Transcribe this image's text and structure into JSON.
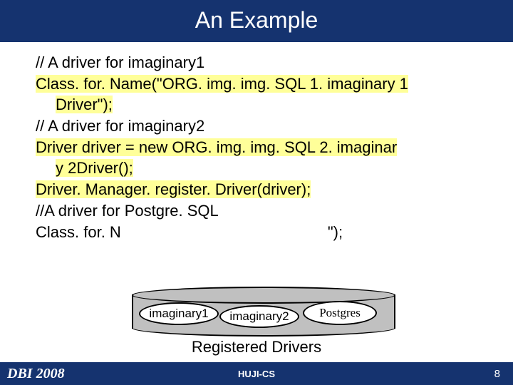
{
  "title": "An Example",
  "code": {
    "c1": "// A driver for imaginary1",
    "c2a": "Class. for. Name(\"ORG. img. img. SQL 1. imaginary 1",
    "c2b": "Driver\");",
    "c3": "// A driver for imaginary2",
    "c4a": "Driver driver = new ORG. img. img. SQL 2. imaginar",
    "c4b": "y 2Driver();",
    "c5": "Driver. Manager. register. Driver(driver);",
    "c6": "//A driver for Postgre. SQL",
    "c7a": "Class. for. N",
    "c7b": "\");"
  },
  "bubbles": {
    "b1": "imaginary1",
    "b2": "imaginary2",
    "b3": "Postgres"
  },
  "caption": "Registered Drivers",
  "footer": {
    "left": "DBI 2008",
    "center": "HUJI-CS",
    "right": "8"
  }
}
